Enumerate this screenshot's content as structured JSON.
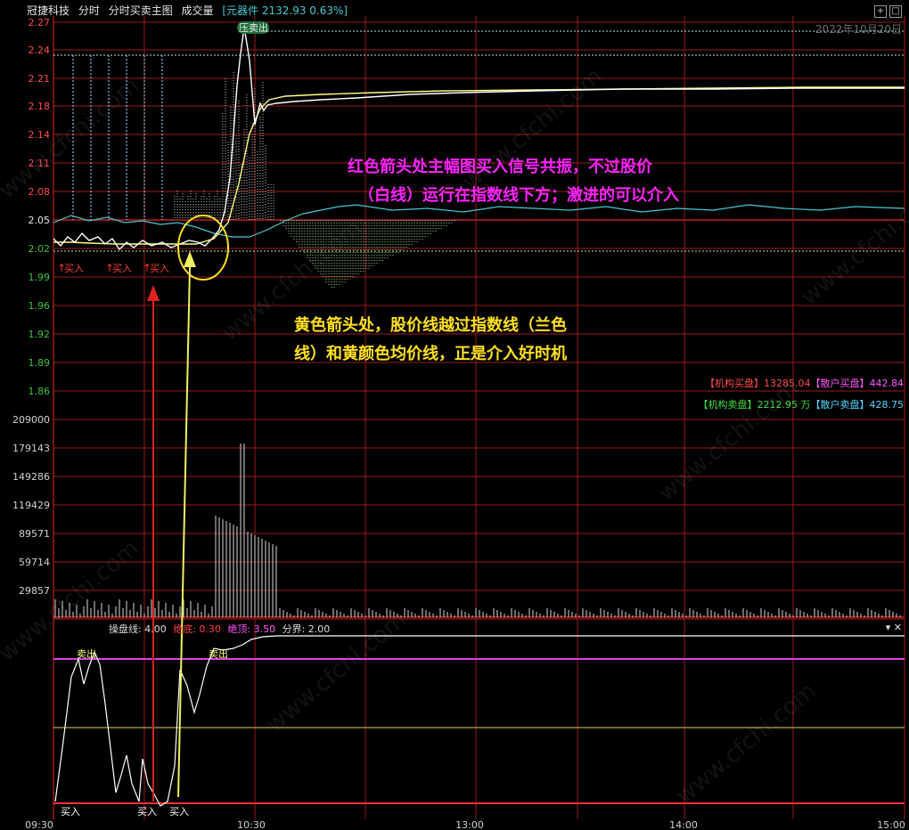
{
  "header": {
    "stock_name": "冠捷科技",
    "tab_time": "分时",
    "tab_main": "分时买卖主图",
    "tab_vol": "成交量",
    "index_info": "[元器件 2132.93 0.63%]"
  },
  "date": "2022年10月20日",
  "price_axis": [
    "2.27",
    "2.24",
    "2.21",
    "2.18",
    "2.14",
    "2.11",
    "2.08",
    "2.05",
    "2.02",
    "1.99",
    "1.96",
    "1.92",
    "1.89",
    "1.86"
  ],
  "volume_axis": [
    "209000",
    "179143",
    "149286",
    "119429",
    "89571",
    "59714",
    "29857"
  ],
  "time_axis": [
    "09:30",
    "10:30",
    "13:00",
    "14:00",
    "15:00"
  ],
  "signals": {
    "buy": "买入",
    "sell_top": "压卖出",
    "sell": "卖出"
  },
  "annotations": {
    "red_line1": "红色箭头处主幅图买入信号共振，不过股价",
    "red_line2": "（白线）运行在指数线下方；激进的可以介入",
    "yellow_line1": "黄色箭头处，股价线越过指数线（兰色",
    "yellow_line2": "线）和黄颜色均价线，正是介入好时机"
  },
  "side_panel": {
    "inst_buy_label": "【机构买盘】",
    "inst_buy_value": "13285.04",
    "retail_buy_label": "【散户买盘】",
    "retail_buy_value": "442.84",
    "inst_sell_label": "【机构卖盘】",
    "inst_sell_value": "2212.95 万",
    "retail_sell_label": "【散户卖盘】",
    "retail_sell_value": "428.75"
  },
  "indicator": {
    "line_label": "操盘线: 4.00",
    "bottom_label": "绝底: 0.30",
    "top_label": "绝顶: 3.50",
    "boundary_label": "分界: 2.00"
  },
  "watermark": "www.cfchi.com",
  "colors": {
    "grid_red": "#9a1a1a",
    "price_white": "#ffffff",
    "avg_yellow": "#ffff80",
    "index_cyan": "#46c8d2",
    "annotation_magenta": "#ff22ff",
    "annotation_yellow": "#ffe020"
  }
}
